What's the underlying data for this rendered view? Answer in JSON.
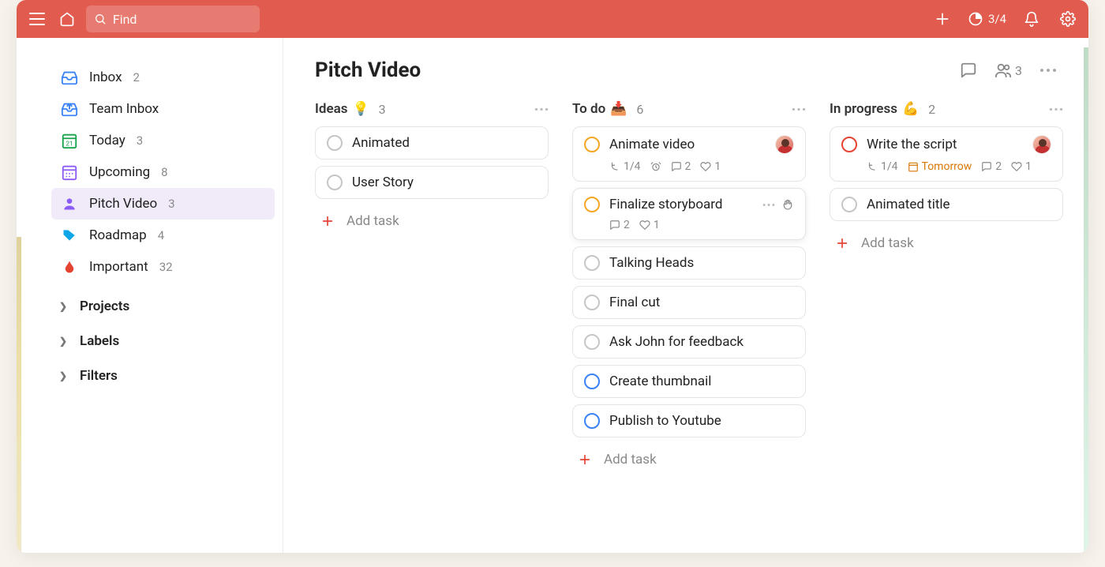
{
  "topbar": {
    "search_placeholder": "Find",
    "ratio": "3/4"
  },
  "sidebar": {
    "items": [
      {
        "label": "Inbox",
        "count": "2"
      },
      {
        "label": "Team Inbox",
        "count": ""
      },
      {
        "label": "Today",
        "count": "3"
      },
      {
        "label": "Upcoming",
        "count": "8"
      },
      {
        "label": "Pitch Video",
        "count": "3"
      },
      {
        "label": "Roadmap",
        "count": "4"
      },
      {
        "label": "Important",
        "count": "32"
      }
    ],
    "sections": [
      {
        "label": "Projects"
      },
      {
        "label": "Labels"
      },
      {
        "label": "Filters"
      }
    ]
  },
  "page": {
    "title": "Pitch Video",
    "people_count": "3"
  },
  "columns": [
    {
      "title": "Ideas",
      "emoji": "💡",
      "count": "3",
      "add_label": "Add task",
      "cards": [
        {
          "title": "Animated",
          "circle": "gray"
        },
        {
          "title": "User Story",
          "circle": "gray"
        }
      ]
    },
    {
      "title": "To do",
      "emoji": "📥",
      "count": "6",
      "add_label": "Add task",
      "cards": [
        {
          "title": "Animate video",
          "circle": "orange",
          "meta": {
            "subtasks": "1/4",
            "alarm": true,
            "comments": "2",
            "likes": "1",
            "avatar": true
          }
        },
        {
          "title": "Finalize storyboard",
          "circle": "orange",
          "hover": true,
          "meta": {
            "comments": "2",
            "likes": "1"
          }
        },
        {
          "title": "Talking Heads",
          "circle": "gray"
        },
        {
          "title": "Final cut",
          "circle": "gray"
        },
        {
          "title": "Ask John for feedback",
          "circle": "gray"
        },
        {
          "title": "Create thumbnail",
          "circle": "blue"
        },
        {
          "title": "Publish to Youtube",
          "circle": "blue"
        }
      ]
    },
    {
      "title": "In progress",
      "emoji": "💪",
      "count": "2",
      "add_label": "Add task",
      "cards": [
        {
          "title": "Write the script",
          "circle": "red",
          "meta": {
            "subtasks": "1/4",
            "due": "Tomorrow",
            "comments": "2",
            "likes": "1",
            "avatar": true
          }
        },
        {
          "title": "Animated title",
          "circle": "gray"
        }
      ]
    }
  ]
}
